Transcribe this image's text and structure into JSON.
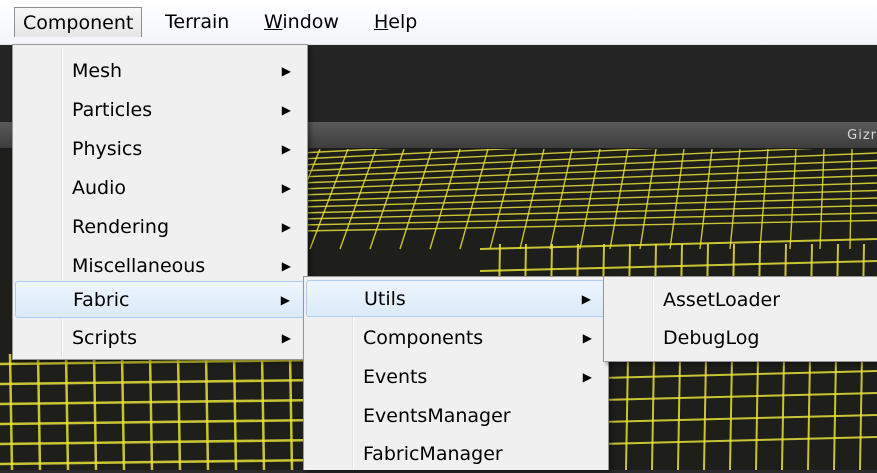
{
  "menubar": {
    "items": [
      {
        "label": "Component",
        "underline_index": -1,
        "open": true
      },
      {
        "label": "Terrain",
        "underline_index": -1,
        "open": false
      },
      {
        "label": "Window",
        "underline_index": 0,
        "open": false
      },
      {
        "label": "Help",
        "underline_index": 0,
        "open": false
      }
    ]
  },
  "scene": {
    "gizmos_label": "Gizr"
  },
  "component_menu": {
    "items": [
      {
        "label": "Mesh",
        "submenu": true
      },
      {
        "label": "Particles",
        "submenu": true
      },
      {
        "label": "Physics",
        "submenu": true
      },
      {
        "label": "Audio",
        "submenu": true
      },
      {
        "label": "Rendering",
        "submenu": true
      },
      {
        "label": "Miscellaneous",
        "submenu": true
      },
      {
        "label": "Fabric",
        "submenu": true,
        "highlighted": true
      },
      {
        "label": "Scripts",
        "submenu": true
      }
    ]
  },
  "fabric_menu": {
    "items": [
      {
        "label": "Utils",
        "submenu": true,
        "highlighted": true
      },
      {
        "label": "Components",
        "submenu": true
      },
      {
        "label": "Events",
        "submenu": true
      },
      {
        "label": "EventsManager",
        "submenu": false
      },
      {
        "label": "FabricManager",
        "submenu": false
      }
    ]
  },
  "utils_menu": {
    "items": [
      {
        "label": "AssetLoader",
        "submenu": false
      },
      {
        "label": "DebugLog",
        "submenu": false
      }
    ]
  },
  "icons": {
    "submenu_arrow": "chevron-right-icon"
  },
  "colors": {
    "menu_bg": "#f0f0f0",
    "highlight_bg": "#dbeaf9",
    "highlight_border": "#aecbf0",
    "grid_line": "#e8e23a",
    "scene_bg": "#1e1e1a"
  }
}
